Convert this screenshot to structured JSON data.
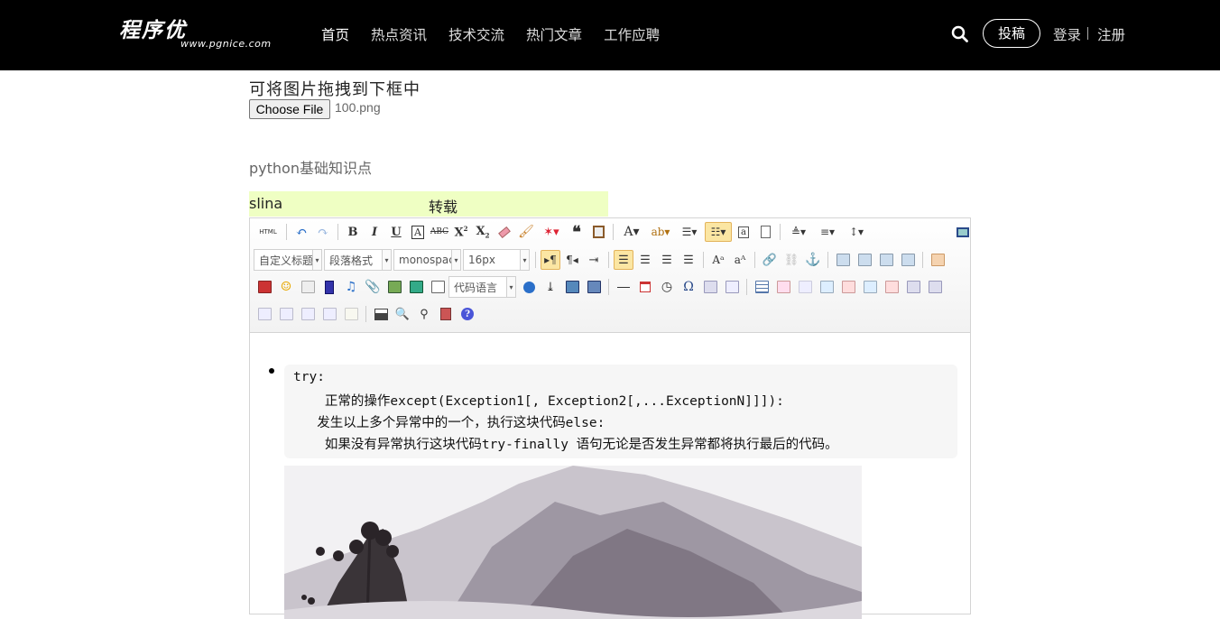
{
  "header": {
    "logo_text": "程序优",
    "logo_subtext": "www.pgnice.com",
    "nav": [
      "首页",
      "热点资讯",
      "技术交流",
      "热门文章",
      "工作应聘"
    ],
    "post_button": "投稿",
    "login": "登录",
    "register": "注册",
    "colors": {
      "background": "#000000",
      "text": "#ffffff"
    }
  },
  "upload": {
    "hint": "可将图片拖拽到下框中",
    "choose_button": "Choose File",
    "file_name": "100.png"
  },
  "article": {
    "title": "python基础知识点",
    "author": "slina",
    "type": "转载"
  },
  "editor": {
    "combos": {
      "custom_title": "自定义标题",
      "paragraph": "段落格式",
      "font_family": "monospace",
      "font_size": "16px",
      "code_language": "代码语言"
    },
    "code_lines": [
      "try:",
      "    正常的操作except(Exception1[, Exception2[,...ExceptionN]]]):",
      "   发生以上多个异常中的一个，执行这块代码else:",
      "    如果没有异常执行这块代码try-finally 语句无论是否发生异常都将执行最后的代码。"
    ],
    "toolbar_icons": [
      "html-icon",
      "undo-icon",
      "redo-icon",
      "bold-icon",
      "italic-icon",
      "underline-icon",
      "font-border-icon",
      "strikethrough-icon",
      "superscript-icon",
      "subscript-icon",
      "eraser-icon",
      "format-match-icon",
      "auto-typeset-icon",
      "blockquote-icon",
      "paste-plain-icon",
      "fore-color-icon",
      "back-color-icon",
      "ordered-list-icon",
      "unordered-list-icon",
      "select-all-icon",
      "clear-doc-icon",
      "row-spacing-top-icon",
      "row-spacing-bottom-icon",
      "line-height-icon",
      "preview-icon"
    ]
  }
}
